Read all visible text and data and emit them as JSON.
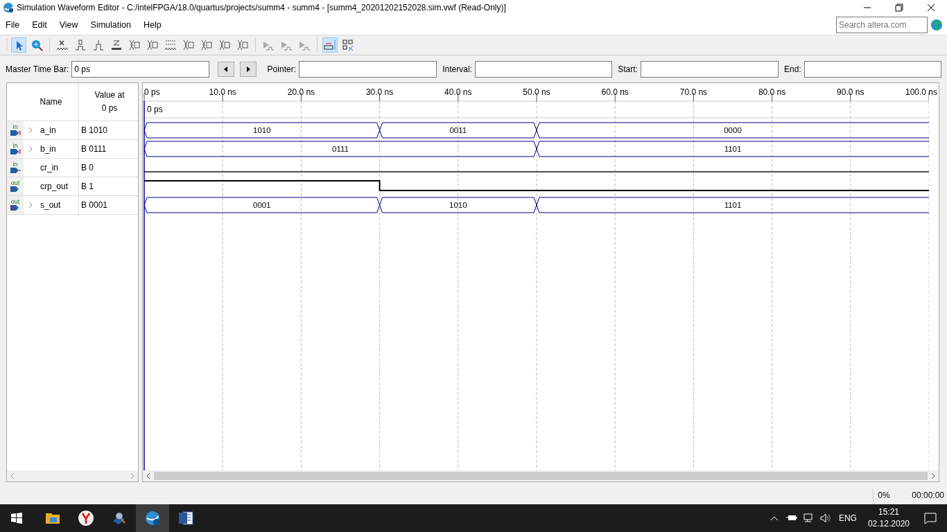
{
  "window": {
    "title": "Simulation Waveform Editor - C:/intelFPGA/18.0/quartus/projects/summ4 - summ4 - [summ4_20201202152028.sim.vwf (Read-Only)]"
  },
  "menu": [
    "File",
    "Edit",
    "View",
    "Simulation",
    "Help"
  ],
  "search": {
    "placeholder": "Search altera.com"
  },
  "toolbar": [
    {
      "kind": "pointer",
      "selected": true
    },
    {
      "kind": "zoom",
      "selected": false
    },
    {
      "kind": "sep"
    },
    {
      "kind": "x",
      "selected": false
    },
    {
      "kind": "zero",
      "selected": false
    },
    {
      "kind": "one",
      "selected": false
    },
    {
      "kind": "z",
      "selected": false
    },
    {
      "kind": "bus",
      "selected": false
    },
    {
      "kind": "bus",
      "selected": false
    },
    {
      "kind": "inv",
      "selected": false
    },
    {
      "kind": "bus",
      "selected": false
    },
    {
      "kind": "bus",
      "selected": false
    },
    {
      "kind": "bus",
      "selected": false
    },
    {
      "kind": "bus",
      "selected": false
    },
    {
      "kind": "sep"
    },
    {
      "kind": "run",
      "selected": false
    },
    {
      "kind": "run",
      "selected": false
    },
    {
      "kind": "run",
      "selected": false
    },
    {
      "kind": "sep"
    },
    {
      "kind": "snap",
      "selected": true
    },
    {
      "kind": "grid",
      "selected": false
    }
  ],
  "timebar": {
    "master_label": "Master Time Bar:",
    "master_value": "0 ps",
    "pointer_label": "Pointer:",
    "interval_label": "Interval:",
    "start_label": "Start:",
    "end_label": "End:"
  },
  "grid_header": {
    "name": "Name",
    "value_at": "Value at",
    "value_time": "0 ps"
  },
  "time_axis": {
    "ticks": [
      "0 ps",
      "10.0 ns",
      "20.0 ns",
      "30.0 ns",
      "40.0 ns",
      "50.0 ns",
      "60.0 ns",
      "70.0 ns",
      "80.0 ns",
      "90.0 ns",
      "100.0 ns"
    ],
    "cursor": "0 ps"
  },
  "signals": [
    {
      "kind": "bus",
      "direction": "in",
      "name": "a_in",
      "value": "B 1010",
      "expanded": false,
      "intervals": [
        {
          "transition": true,
          "value": "1010"
        },
        {
          "transition": false
        },
        {
          "transition": false
        },
        {
          "transition": true,
          "value": "0011"
        },
        {
          "transition": false
        },
        {
          "transition": true,
          "value": "0000"
        },
        {
          "transition": false
        },
        {
          "transition": false
        },
        {
          "transition": false
        },
        {
          "transition": false
        }
      ]
    },
    {
      "kind": "bus",
      "direction": "in",
      "name": "b_in",
      "value": "B 0111",
      "expanded": false,
      "intervals": [
        {
          "transition": true,
          "value": "0111"
        },
        {
          "transition": false
        },
        {
          "transition": false
        },
        {
          "transition": false
        },
        {
          "transition": false
        },
        {
          "transition": true,
          "value": "1101"
        },
        {
          "transition": false
        },
        {
          "transition": false
        },
        {
          "transition": false
        },
        {
          "transition": false
        }
      ]
    },
    {
      "kind": "bit",
      "direction": "in",
      "name": "cr_in",
      "value": "B 0",
      "intervals": [
        {
          "high": false
        },
        {
          "high": false
        },
        {
          "high": false
        },
        {
          "high": false
        },
        {
          "high": false
        },
        {
          "high": false
        },
        {
          "high": false
        },
        {
          "high": false
        },
        {
          "high": false
        },
        {
          "high": false
        }
      ]
    },
    {
      "kind": "bit",
      "direction": "out",
      "name": "crp_out",
      "value": "B 1",
      "intervals": [
        {
          "high": true
        },
        {
          "high": true
        },
        {
          "high": true
        },
        {
          "high": false
        },
        {
          "high": false
        },
        {
          "high": false
        },
        {
          "high": false
        },
        {
          "high": false
        },
        {
          "high": false
        },
        {
          "high": false
        }
      ]
    },
    {
      "kind": "bus",
      "direction": "out",
      "name": "s_out",
      "value": "B 0001",
      "expanded": false,
      "intervals": [
        {
          "transition": true,
          "value": "0001"
        },
        {
          "transition": false
        },
        {
          "transition": false
        },
        {
          "transition": true,
          "value": "1010"
        },
        {
          "transition": false
        },
        {
          "transition": true,
          "value": "1101"
        },
        {
          "transition": false
        },
        {
          "transition": false
        },
        {
          "transition": false
        },
        {
          "transition": false
        }
      ]
    }
  ],
  "status": {
    "progress": "0%",
    "elapsed": "00:00:00"
  },
  "taskbar": {
    "apps": [
      {
        "kind": "explorer",
        "active": false
      },
      {
        "kind": "yandex",
        "active": false
      },
      {
        "kind": "search",
        "active": false
      },
      {
        "kind": "quartus",
        "active": true
      },
      {
        "kind": "word",
        "active": false
      }
    ],
    "language": "ENG",
    "time": "15:21",
    "date": "02.12.2020"
  }
}
